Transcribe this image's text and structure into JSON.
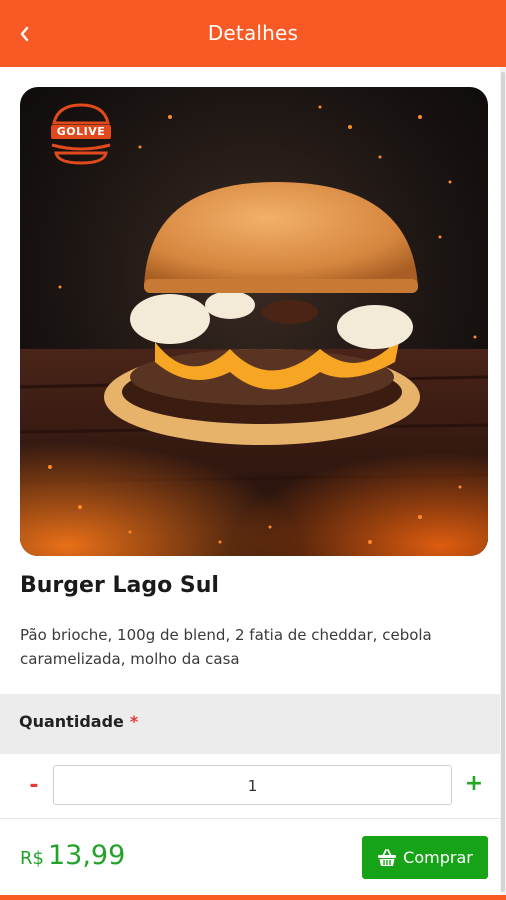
{
  "header": {
    "title": "Detalhes",
    "back_icon": "chevron-left-icon"
  },
  "product": {
    "logo_text": "GOLIVE",
    "name": "Burger Lago Sul",
    "description": "Pão brioche, 100g de blend, 2 fatia de cheddar, cebola caramelizada, molho da casa"
  },
  "quantity": {
    "label": "Quantidade",
    "required_mark": "*",
    "value": "1",
    "minus_label": "-",
    "plus_label": "+"
  },
  "footer": {
    "currency": "R$",
    "price": "13,99",
    "buy_label": "Comprar",
    "buy_icon": "shopping-basket-icon"
  },
  "colors": {
    "brand": "#f95a25",
    "buy_green": "#17a317",
    "price_green": "#22a22a",
    "required_red": "#e53935"
  }
}
